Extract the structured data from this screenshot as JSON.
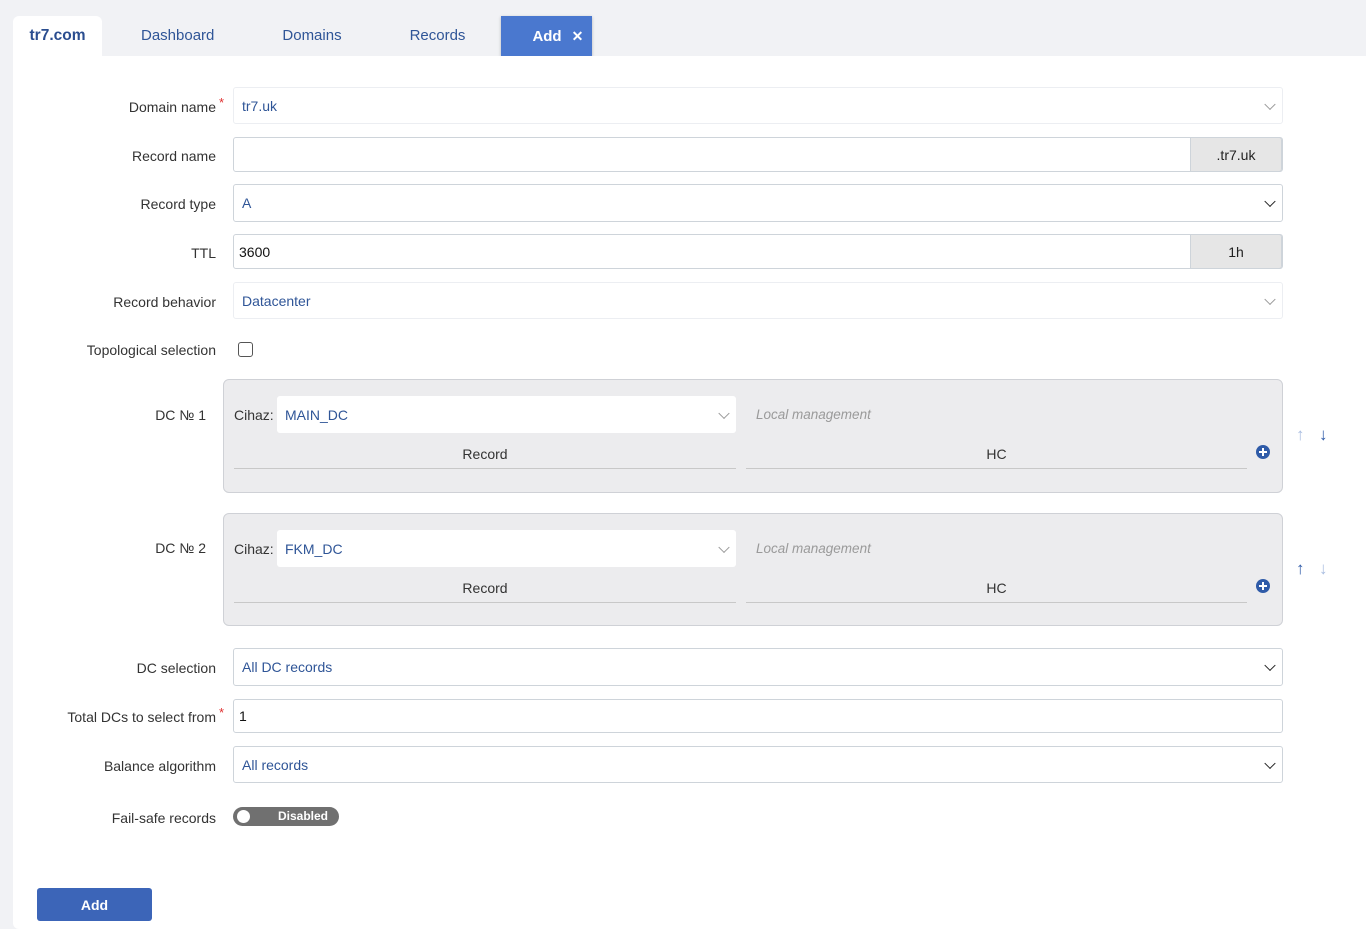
{
  "tabs": {
    "brand": "tr7.com",
    "dashboard": "Dashboard",
    "domains": "Domains",
    "records": "Records",
    "add": "Add",
    "close_glyph": "✕"
  },
  "form": {
    "domain_name": {
      "label": "Domain name",
      "required_mark": "*",
      "value": "tr7.uk"
    },
    "record_name": {
      "label": "Record name",
      "value": "",
      "suffix": ".tr7.uk"
    },
    "record_type": {
      "label": "Record type",
      "value": "A"
    },
    "ttl": {
      "label": "TTL",
      "value": "3600",
      "suffix": "1h"
    },
    "record_behavior": {
      "label": "Record behavior",
      "value": "Datacenter"
    },
    "topological_selection": {
      "label": "Topological selection",
      "checked": false
    },
    "dcs": [
      {
        "label": "DC № 1",
        "cihaz_label": "Cihaz:",
        "cihaz_value": "MAIN_DC",
        "local": "Local management",
        "col_record": "Record",
        "col_hc": "HC",
        "up_enabled": false,
        "down_enabled": true
      },
      {
        "label": "DC № 2",
        "cihaz_label": "Cihaz:",
        "cihaz_value": "FKM_DC",
        "local": "Local management",
        "col_record": "Record",
        "col_hc": "HC",
        "up_enabled": true,
        "down_enabled": false
      }
    ],
    "dc_selection": {
      "label": "DC selection",
      "value": "All DC records"
    },
    "total_dcs": {
      "label": "Total DCs to select from",
      "required_mark": "*",
      "value": "1"
    },
    "balance_algorithm": {
      "label": "Balance algorithm",
      "value": "All records"
    },
    "fail_safe": {
      "label": "Fail-safe records",
      "toggle_text": "Disabled",
      "enabled": false
    }
  },
  "actions": {
    "add_button": "Add"
  },
  "icons": {
    "arrow_up": "↑",
    "arrow_down": "↓"
  },
  "colors": {
    "accent": "#4a78cf",
    "link_text": "#2f5597",
    "button": "#3c65b8"
  }
}
